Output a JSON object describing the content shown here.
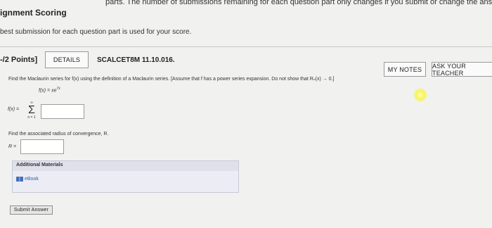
{
  "header": {
    "top_note": "parts. The number of submissions remaining for each question part only changes if you submit or change the answer.",
    "title": "ignment Scoring",
    "subtitle": "best submission for each question part is used for your score."
  },
  "question": {
    "points": "-/2 Points]",
    "details_label": "DETAILS",
    "code": "SCALCET8M 11.10.016.",
    "my_notes_label": "MY NOTES",
    "ask_teacher_label": "ASK YOUR TEACHER",
    "prompt": "Find the Maclaurin series for f(x) using the definition of a Maclaurin series. [Assume that f has a power series expansion. Do not show that Rₙ(x) → 0.]",
    "function_lhs": "f(x) = xe",
    "function_exp": "7x",
    "series_lhs": "f(x) =",
    "sigma_top": "∞",
    "sigma_symbol": "Σ",
    "sigma_bottom": "n = 1",
    "series_value": "",
    "radius_prompt": "Find the associated radius of convergence, R.",
    "radius_lhs": "R =",
    "radius_value": ""
  },
  "materials": {
    "title": "Additional Materials",
    "ebook_label": "eBook"
  },
  "actions": {
    "submit_label": "Submit Answer"
  },
  "colors": {
    "background": "#f1f1ef",
    "link": "#2b5fa8",
    "highlight": "#f7f35a"
  }
}
